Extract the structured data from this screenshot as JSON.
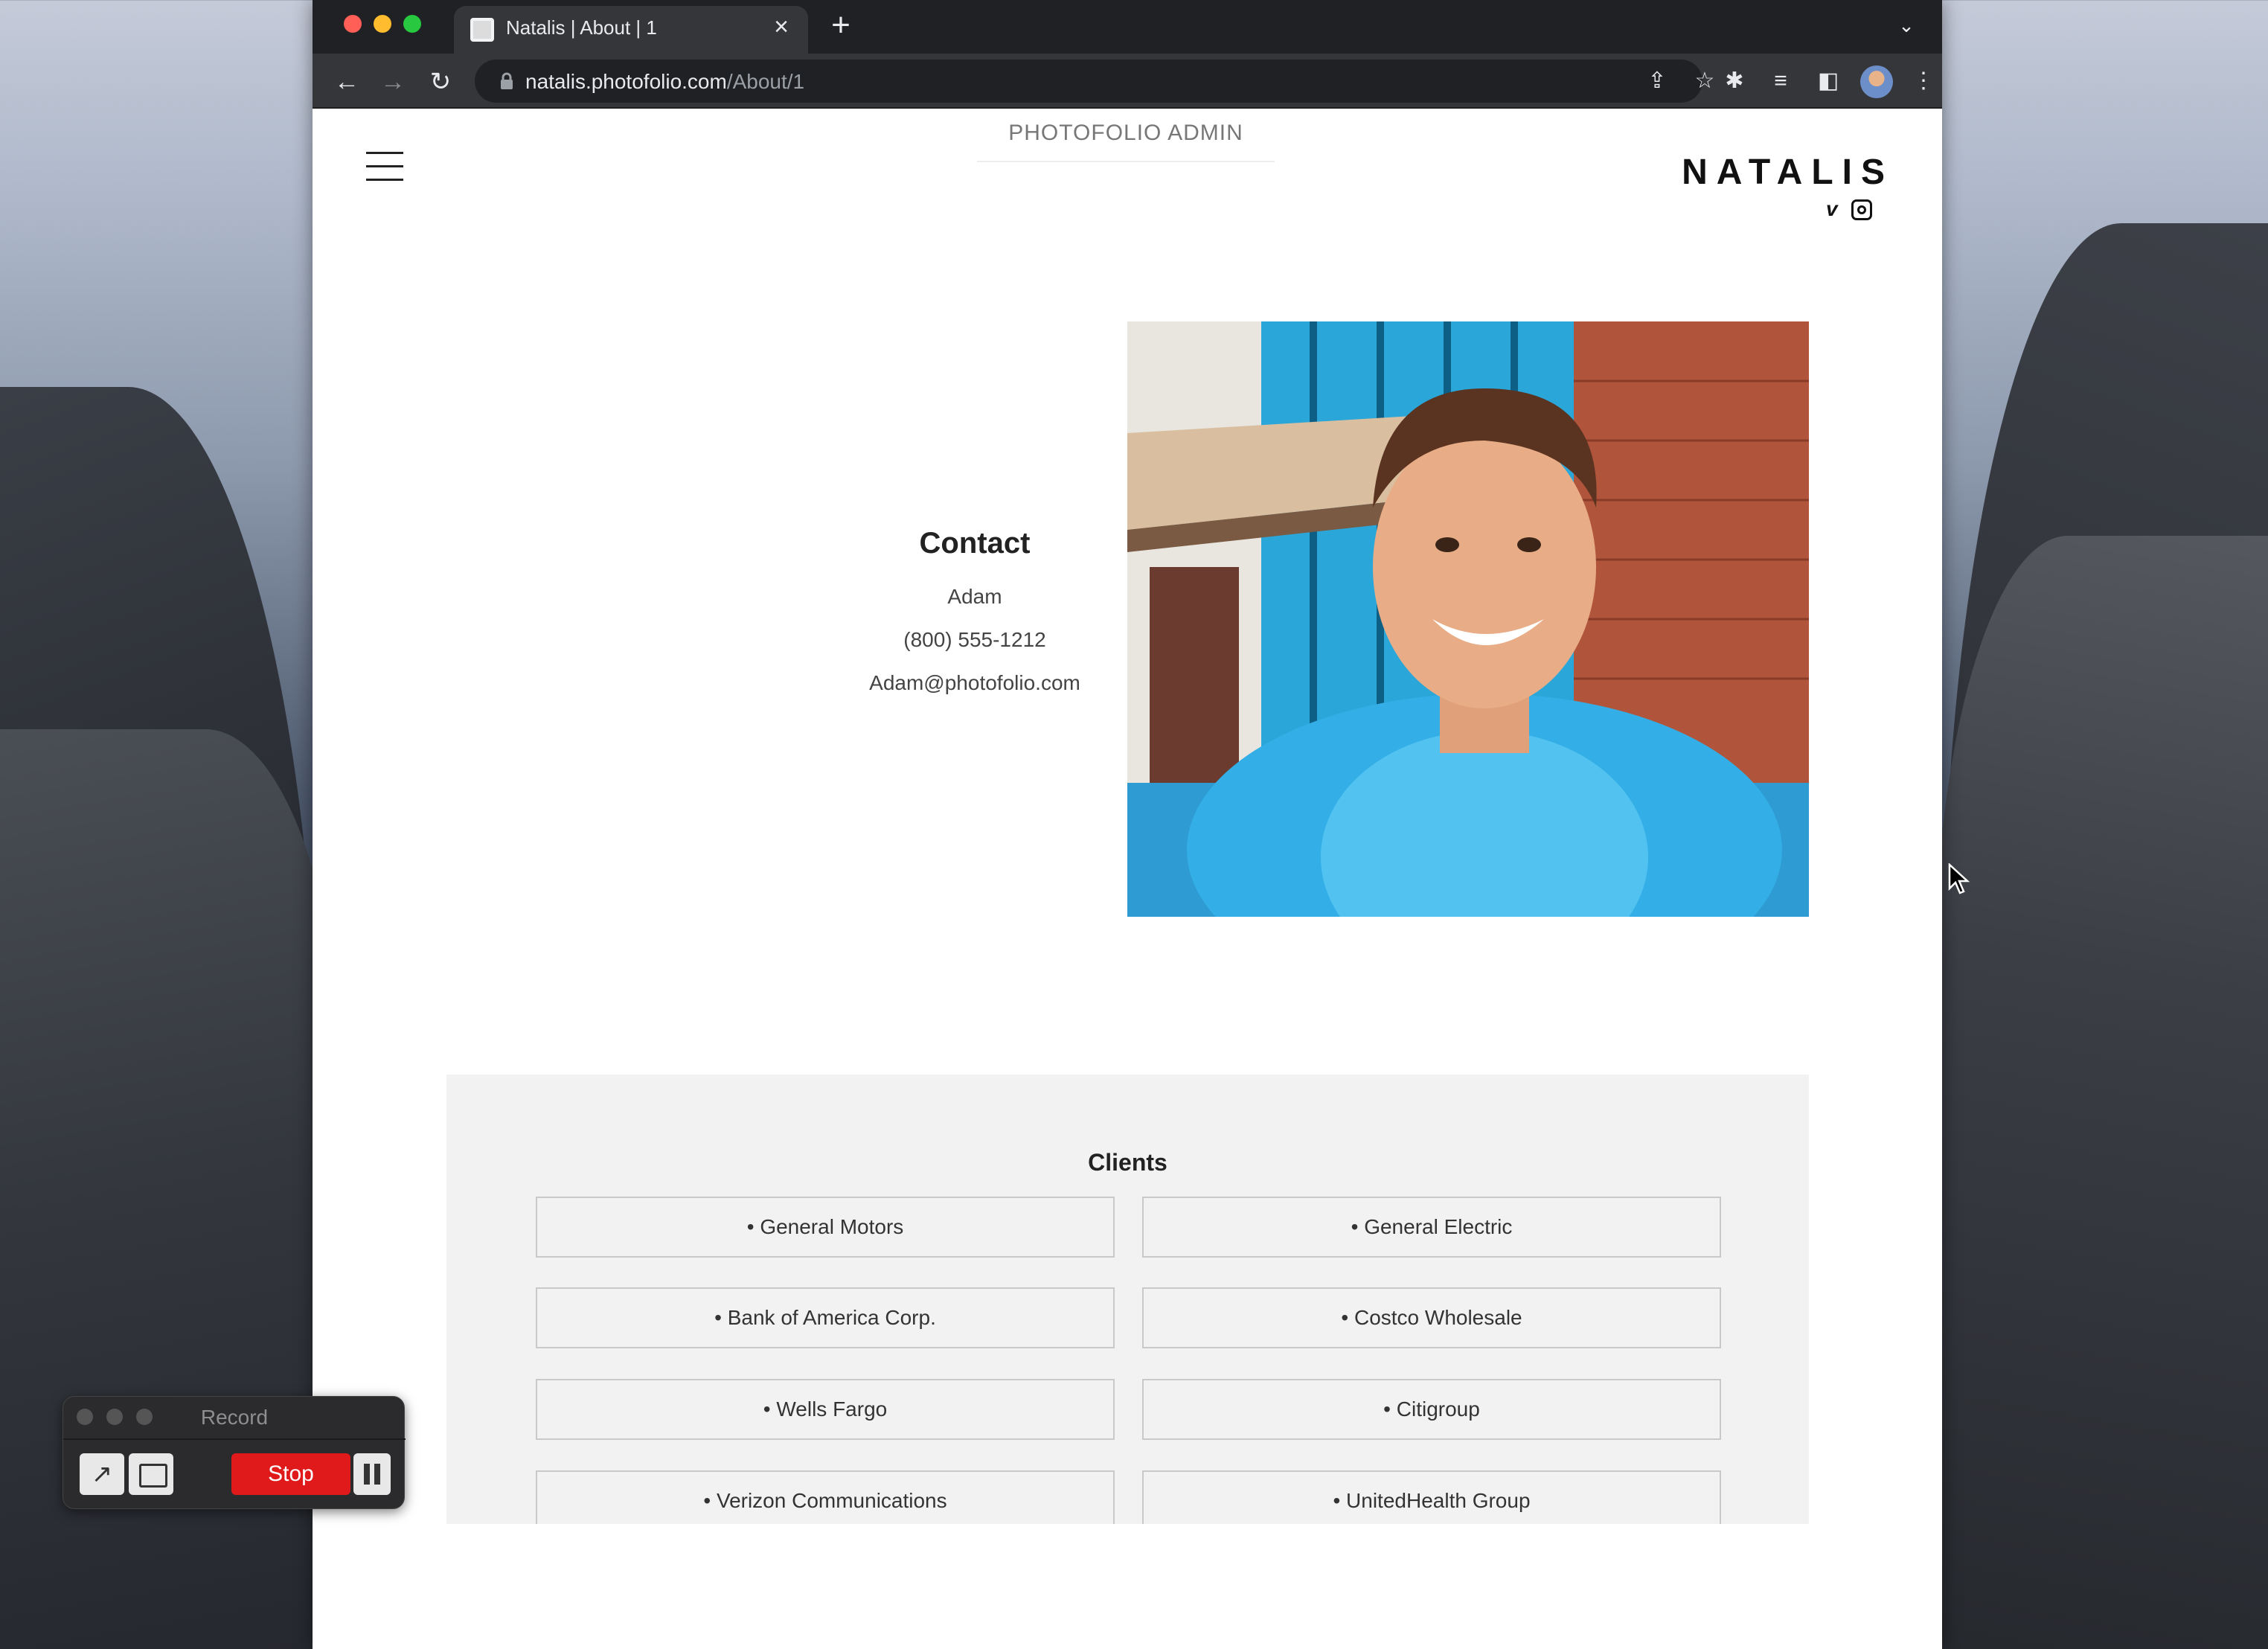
{
  "browser": {
    "tab_title": "Natalis | About | 1",
    "url_host": "natalis.photofolio.com",
    "url_path": "/About/1"
  },
  "header": {
    "admin_label": "PHOTOFOLIO ADMIN",
    "brand": "NATALIS"
  },
  "contact": {
    "title": "Contact",
    "name": "Adam",
    "phone": "(800) 555-1212",
    "email": "Adam@photofolio.com"
  },
  "clients": {
    "title": "Clients",
    "items": [
      "General Motors",
      "General Electric",
      "Bank of America Corp.",
      "Costco Wholesale",
      "Wells Fargo",
      "Citigroup",
      "Verizon Communications",
      "UnitedHealth Group"
    ]
  },
  "recorder": {
    "title": "Record",
    "stop_label": "Stop"
  },
  "icons": {
    "close": "close-icon",
    "new_tab": "plus-icon",
    "menu": "hamburger-icon",
    "social": [
      "vimeo-icon",
      "instagram-icon"
    ]
  }
}
